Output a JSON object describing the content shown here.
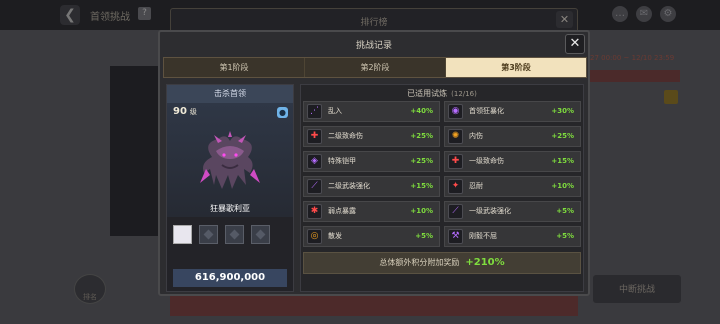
{
  "background": {
    "window_title": "首领挑战",
    "help_icon": "?",
    "rank_title": "排行榜",
    "time_text": "27 00:00 ~ 12/10 23:59",
    "right_button": "中断挑战",
    "left_badge": "排名"
  },
  "dialog": {
    "title": "挑战记录",
    "tabs": [
      {
        "label": "第1阶段",
        "active": false
      },
      {
        "label": "第2阶段",
        "active": false
      },
      {
        "label": "第3阶段",
        "active": true
      }
    ]
  },
  "boss": {
    "header": "击杀首领",
    "level": "90",
    "level_unit": "级",
    "name": "狂暴歌利亚",
    "score": "616,900,000"
  },
  "trials": {
    "header": "已适用试炼",
    "count": "(12/16)",
    "items": [
      {
        "name": "乱入",
        "value": "+40%",
        "icon": "claw-icon",
        "color": "#b56cff"
      },
      {
        "name": "首领狂暴化",
        "value": "+30%",
        "icon": "rage-icon",
        "color": "#b56cff"
      },
      {
        "name": "二级致命伤",
        "value": "+25%",
        "icon": "wound-icon",
        "color": "#ff4a4a"
      },
      {
        "name": "内伤",
        "value": "+25%",
        "icon": "internal-icon",
        "color": "#f0a020"
      },
      {
        "name": "特殊铠甲",
        "value": "+25%",
        "icon": "armor-icon",
        "color": "#b56cff"
      },
      {
        "name": "一级致命伤",
        "value": "+15%",
        "icon": "wound-icon",
        "color": "#ff4a4a"
      },
      {
        "name": "二级武装强化",
        "value": "+15%",
        "icon": "sword-icon",
        "color": "#b56cff"
      },
      {
        "name": "忍耐",
        "value": "+10%",
        "icon": "endure-icon",
        "color": "#ff4a4a"
      },
      {
        "name": "弱点暴露",
        "value": "+10%",
        "icon": "weak-icon",
        "color": "#ff4a4a"
      },
      {
        "name": "一级武装强化",
        "value": "+5%",
        "icon": "sword-icon",
        "color": "#b56cff"
      },
      {
        "name": "散发",
        "value": "+5%",
        "icon": "eye-icon",
        "color": "#f0a020"
      },
      {
        "name": "刚毅不屈",
        "value": "+5%",
        "icon": "hammer-icon",
        "color": "#b56cff"
      }
    ],
    "bonus_label": "总体额外积分附加奖励",
    "bonus_value": "+210%"
  }
}
